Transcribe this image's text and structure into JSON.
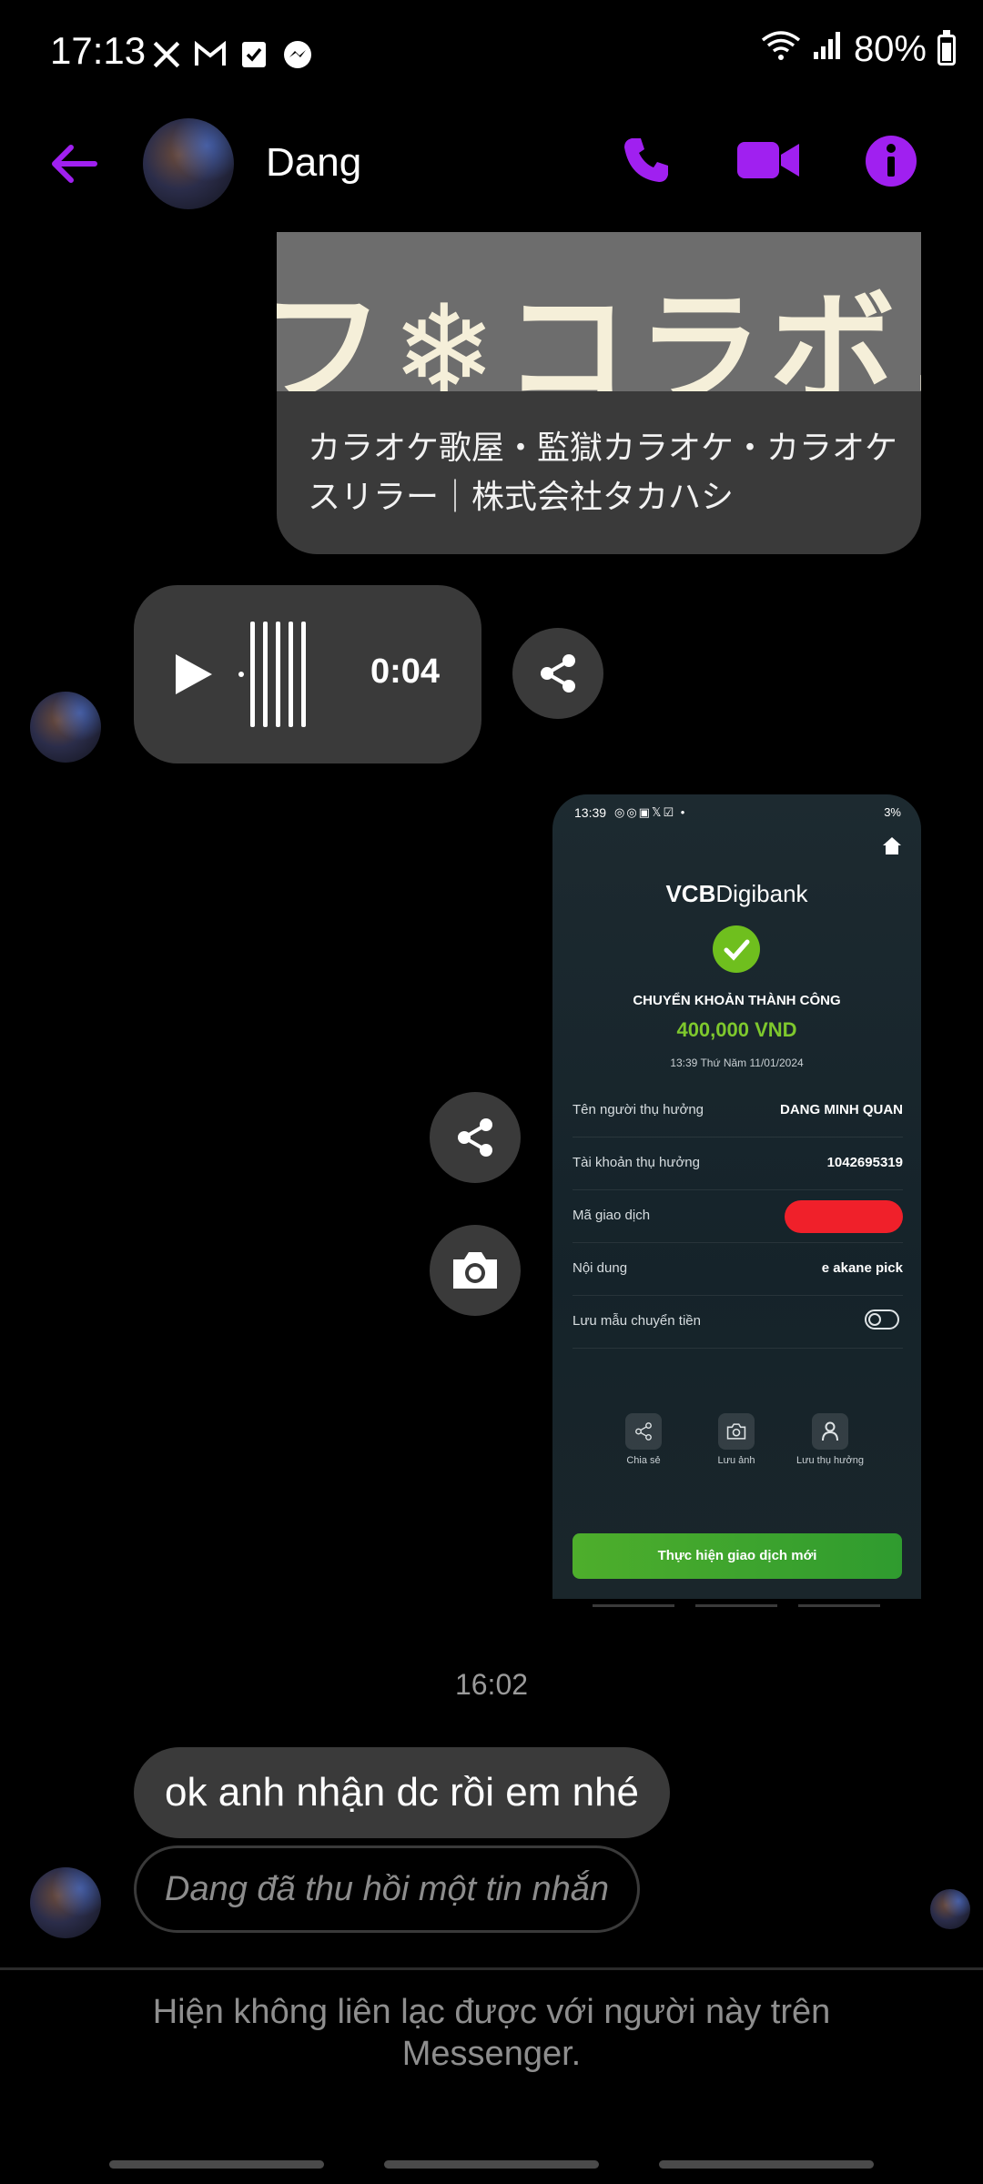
{
  "status_bar": {
    "time": "17:13",
    "battery": "80%",
    "battery_level": 0.8,
    "icons": [
      "x-icon",
      "gmail-icon",
      "checklist-icon",
      "messenger-icon",
      "wifi-icon",
      "signal-icon",
      "battery-icon"
    ]
  },
  "header": {
    "contact_name": "Dang",
    "accent_color": "#a020f0"
  },
  "link_preview": {
    "image_text": "フ❄コラボコ",
    "title": "カラオケ歌屋・監獄カラオケ・カラオケスリラー｜株式会社タカハシ"
  },
  "voice_message": {
    "duration": "0:04"
  },
  "receipt": {
    "status_time": "13:39",
    "battery": "3%",
    "brand": "VCB",
    "brand_suffix": "Digibank",
    "status": "CHUYỂN KHOẢN THÀNH CÔNG",
    "amount": "400,000 VND",
    "datetime": "13:39 Thứ Năm 11/01/2024",
    "rows": [
      {
        "label": "Tên người thụ hưởng",
        "value": "DANG MINH QUAN"
      },
      {
        "label": "Tài khoản thụ hưởng",
        "value": "1042695319"
      },
      {
        "label": "Mã giao dịch",
        "value": ""
      },
      {
        "label": "Nội dung",
        "value": "e akane pick"
      },
      {
        "label": "Lưu mẫu chuyển tiền",
        "value": ""
      }
    ],
    "actions": [
      {
        "label": "Chia sẻ",
        "icon": "share-icon"
      },
      {
        "label": "Lưu ảnh",
        "icon": "camera-icon"
      },
      {
        "label": "Lưu thụ hưởng",
        "icon": "user-icon"
      }
    ],
    "cta": "Thực hiện giao dịch mới"
  },
  "timestamp": "16:02",
  "messages": {
    "ok": "ok anh nhận dc rồi em nhé",
    "unsent": "Dang đã thu hồi một tin nhắn"
  },
  "footer_note": "Hiện không liên lạc được với người này trên Messenger."
}
